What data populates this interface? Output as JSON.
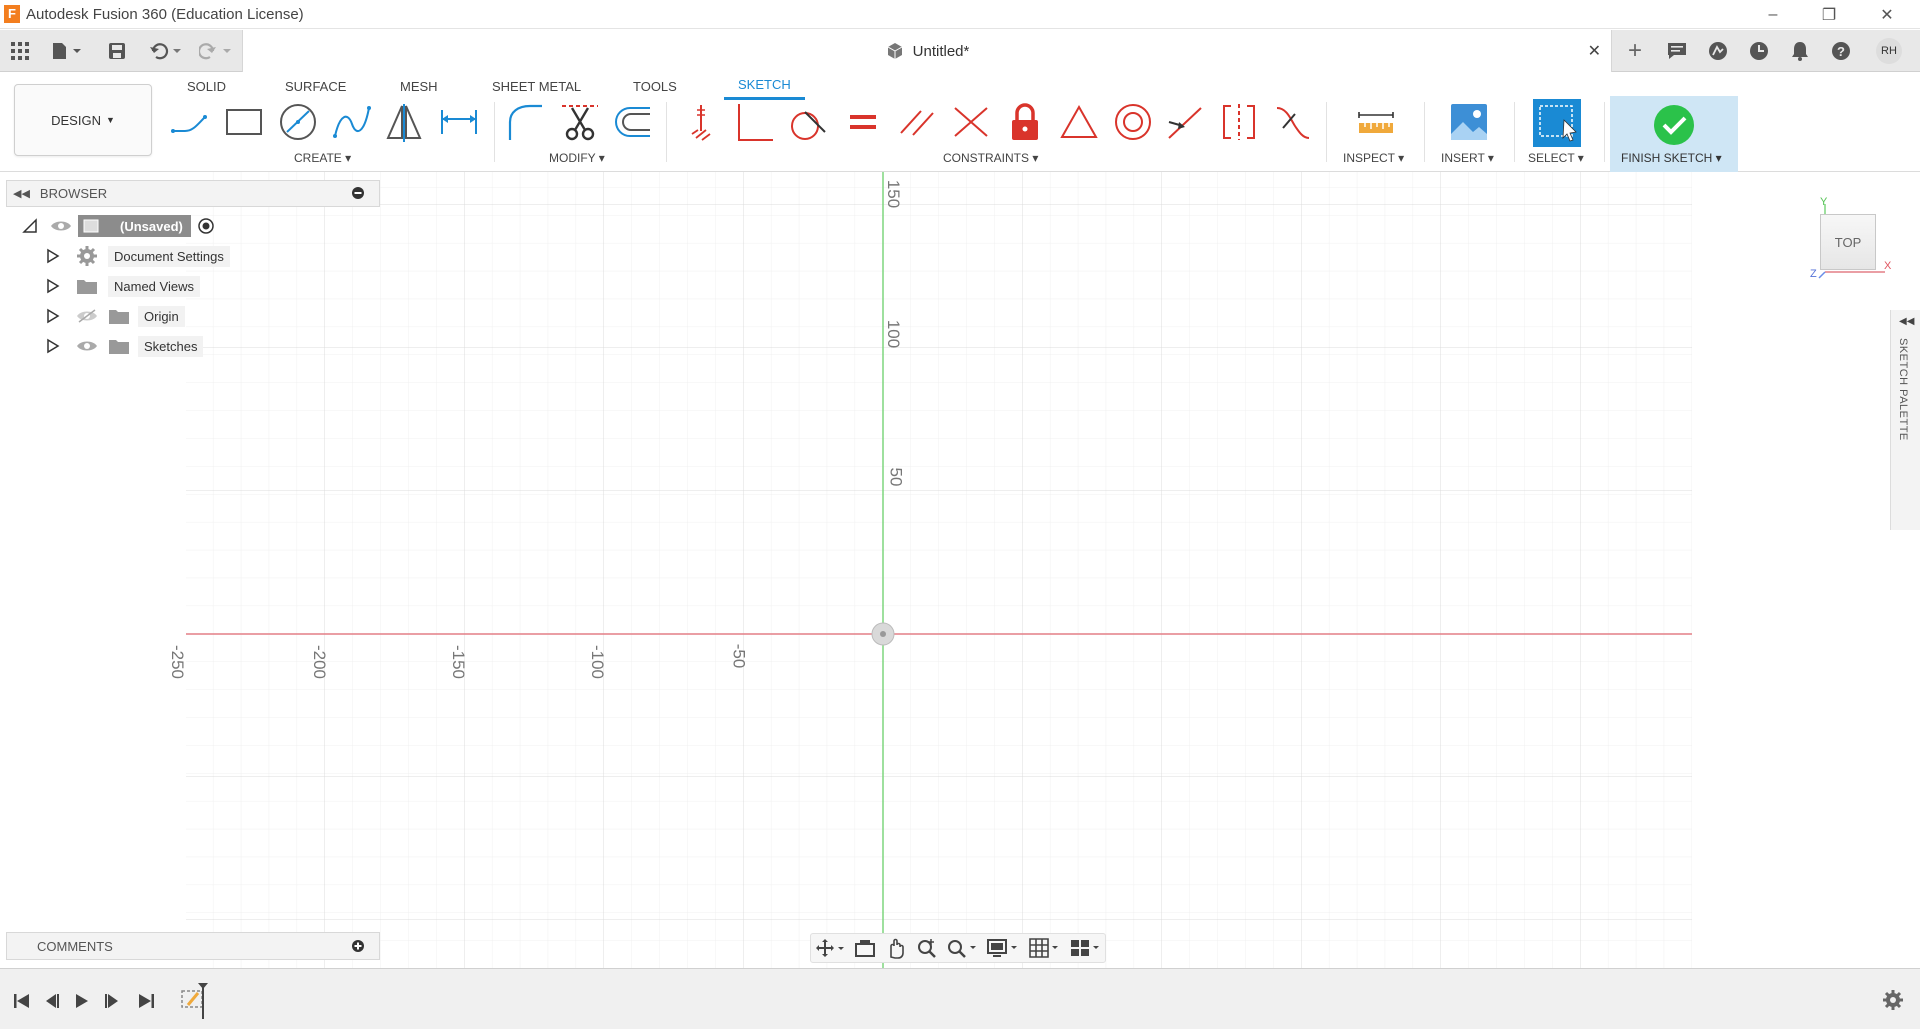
{
  "window": {
    "title": "Autodesk Fusion 360 (Education License)",
    "logo_letter": "F"
  },
  "appbar": {
    "doc_title": "Untitled*",
    "user_initials": "RH"
  },
  "toolbar": {
    "workspace": "DESIGN",
    "tabs": [
      "SOLID",
      "SURFACE",
      "MESH",
      "SHEET METAL",
      "TOOLS",
      "SKETCH"
    ],
    "active_tab": "SKETCH",
    "groups": [
      "CREATE",
      "MODIFY",
      "CONSTRAINTS",
      "INSPECT",
      "INSERT",
      "SELECT",
      "FINISH SKETCH"
    ]
  },
  "browser": {
    "title": "BROWSER",
    "root": "(Unsaved)",
    "items": [
      "Document Settings",
      "Named Views",
      "Origin",
      "Sketches"
    ]
  },
  "comments": {
    "title": "COMMENTS"
  },
  "canvas": {
    "x_ticks": [
      "-250",
      "-200",
      "-150",
      "-100",
      "-50"
    ],
    "y_ticks": [
      "150",
      "100",
      "50"
    ]
  },
  "viewcube": {
    "face": "TOP",
    "axis_y": "Y",
    "axis_x": "X",
    "axis_z": "Z"
  },
  "sketch_palette": {
    "label": "SKETCH PALETTE"
  },
  "colors": {
    "accent": "#1a8ad4",
    "sketch_red": "#d9342b",
    "x_axis": "#e37f86",
    "y_axis": "#7ed67e",
    "finish_green": "#2bc24a"
  }
}
